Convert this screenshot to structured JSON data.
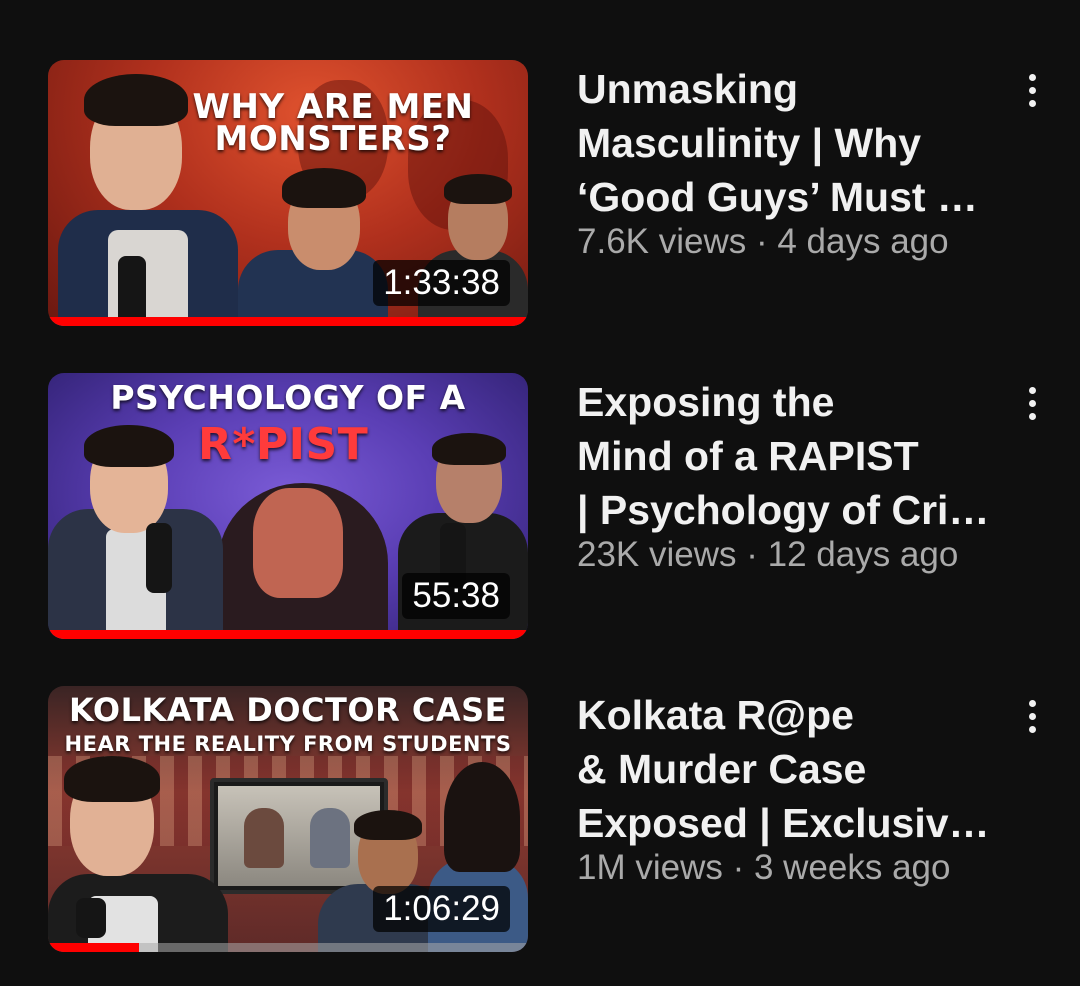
{
  "colors": {
    "background": "#0f0f0f",
    "title_text": "#f1f1f1",
    "meta_text": "#aaaaaa",
    "progress": "#ff0000"
  },
  "videos": [
    {
      "title_lines": [
        "Unmasking",
        "Masculinity | Why",
        "‘Good Guys’ Must …"
      ],
      "stats": "7.6K views · 4 days ago",
      "duration": "1:33:38",
      "watched": 1.0,
      "thumb_lines": [
        "WHY ARE MEN",
        "MONSTERS?"
      ],
      "menu_icon": "more-vert-icon"
    },
    {
      "title_lines": [
        "Exposing the",
        "Mind of a RAPIST",
        "| Psychology of Cri…"
      ],
      "stats": "23K views · 12 days ago",
      "duration": "55:38",
      "watched": 1.0,
      "thumb_lines": [
        "PSYCHOLOGY OF A",
        "R*PIST"
      ],
      "menu_icon": "more-vert-icon"
    },
    {
      "title_lines": [
        "Kolkata R@pe",
        "& Murder Case",
        "Exposed | Exclusiv…"
      ],
      "stats": "1M views · 3 weeks ago",
      "duration": "1:06:29",
      "watched": 0.19,
      "thumb_lines": [
        "KOLKATA DOCTOR CASE",
        "HEAR THE REALITY FROM STUDENTS"
      ],
      "menu_icon": "more-vert-icon"
    }
  ]
}
